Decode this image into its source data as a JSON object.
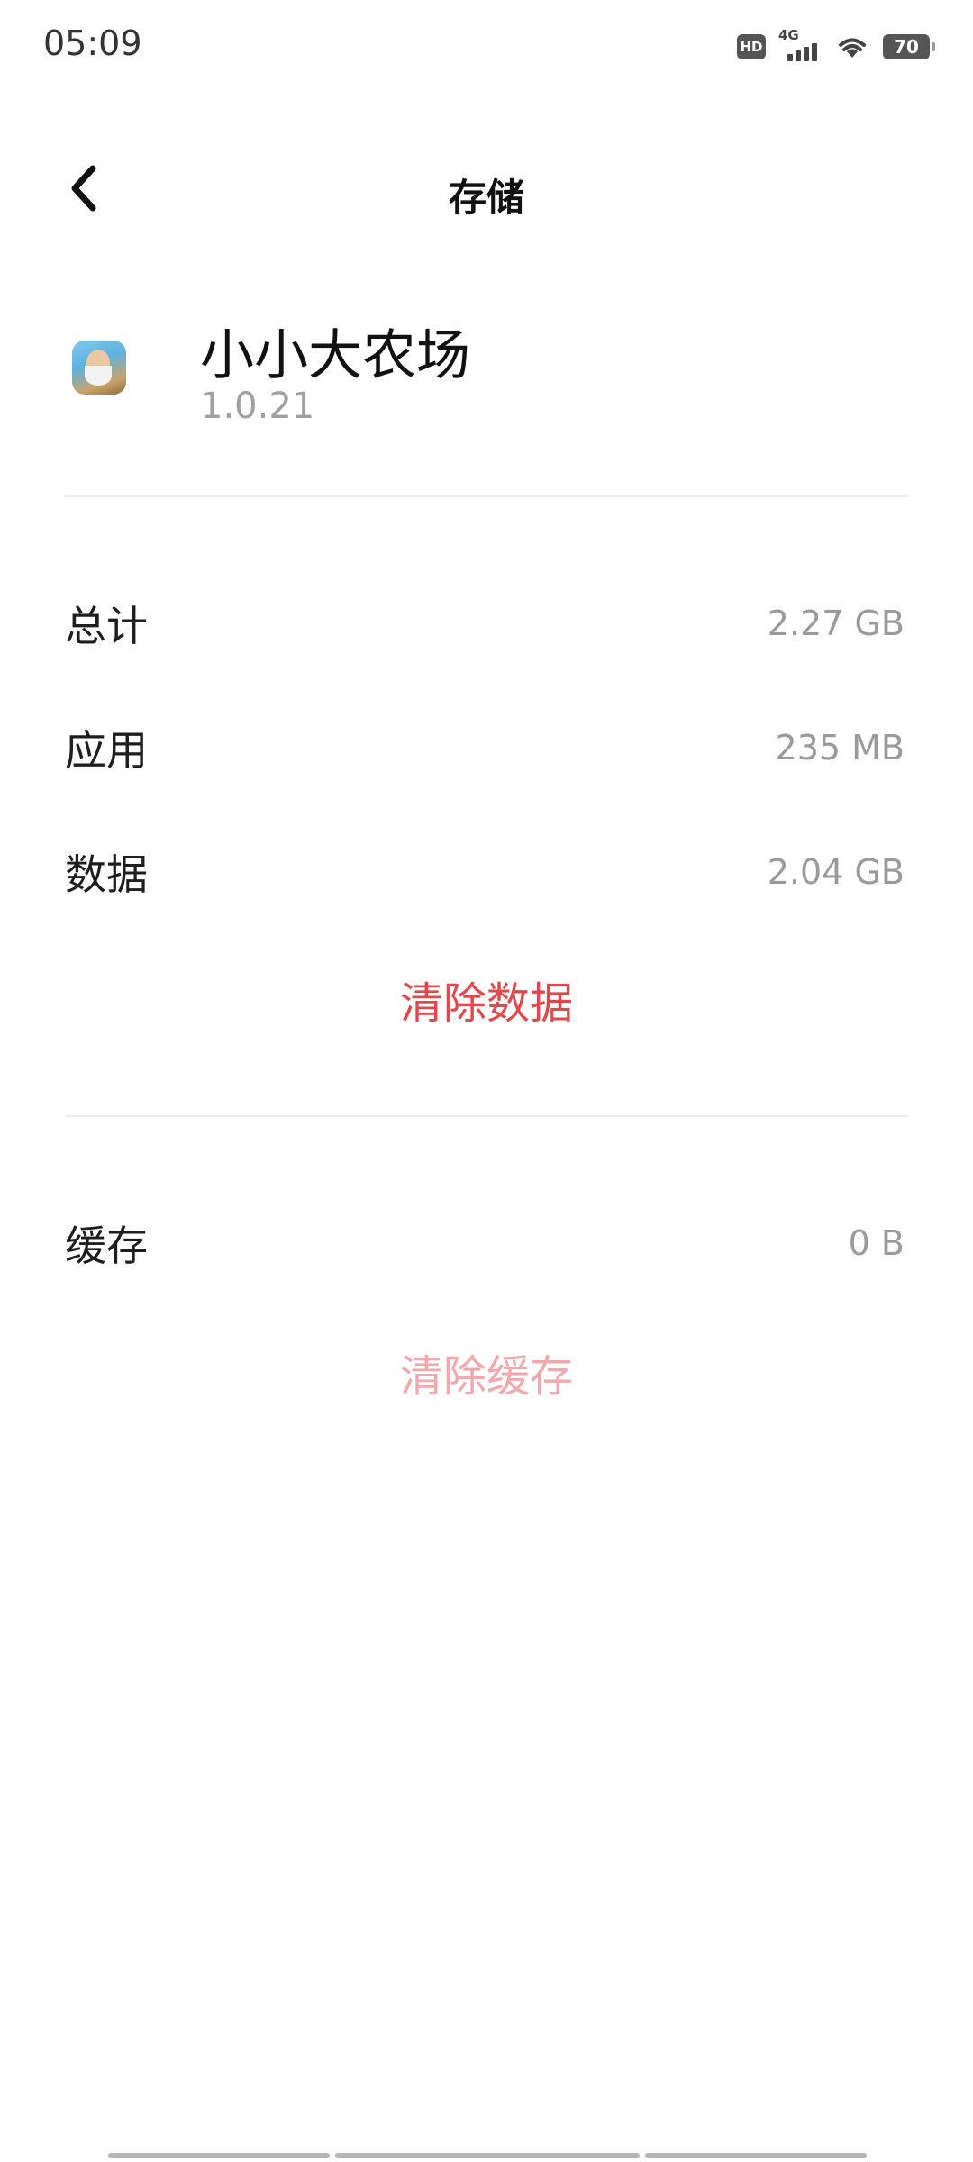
{
  "status_bar": {
    "time": "05:09",
    "hd_label": "HD",
    "network_label": "4G",
    "battery_level": "70"
  },
  "title_bar": {
    "title": "存储"
  },
  "app": {
    "name": "小小大农场",
    "version": "1.0.21"
  },
  "storage": {
    "rows": [
      {
        "label": "总计",
        "value": "2.27 GB"
      },
      {
        "label": "应用",
        "value": "235 MB"
      },
      {
        "label": "数据",
        "value": "2.04 GB"
      }
    ],
    "clear_data_label": "清除数据"
  },
  "cache": {
    "label": "缓存",
    "value": "0 B",
    "clear_cache_label": "清除缓存"
  },
  "colors": {
    "accent_red": "#e0484c",
    "disabled_red": "#f2a9ad",
    "value_gray": "#9a9a9a",
    "divider": "#ececec"
  }
}
